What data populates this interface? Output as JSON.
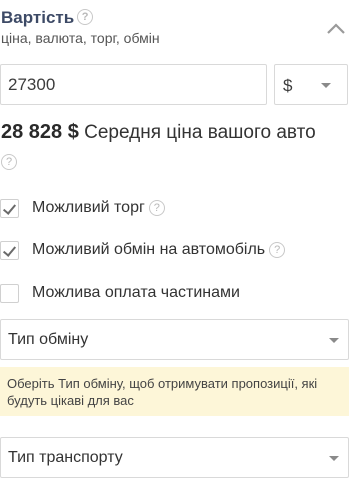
{
  "header": {
    "title": "Вартість",
    "subtitle": "ціна, валюта, торг, обмін",
    "collapse_icon": "chevron-up-icon"
  },
  "price": {
    "value": "27300",
    "currency": "$"
  },
  "average": {
    "amount": "28 828 $",
    "label": "Середня ціна вашого авто"
  },
  "options": [
    {
      "label": "Можливий торг",
      "checked": true,
      "has_help": true
    },
    {
      "label": "Можливий обмін на автомобіль",
      "checked": true,
      "has_help": true
    },
    {
      "label": "Можлива оплата частинами",
      "checked": false,
      "has_help": false
    }
  ],
  "exchange_type": {
    "label": "Тип обміну"
  },
  "notice": {
    "text": "Оберіть Тип обміну, щоб отримувати пропозиції, які будуть цікаві для вас"
  },
  "transport_type": {
    "label": "Тип транспорту"
  },
  "help_glyph": "?"
}
